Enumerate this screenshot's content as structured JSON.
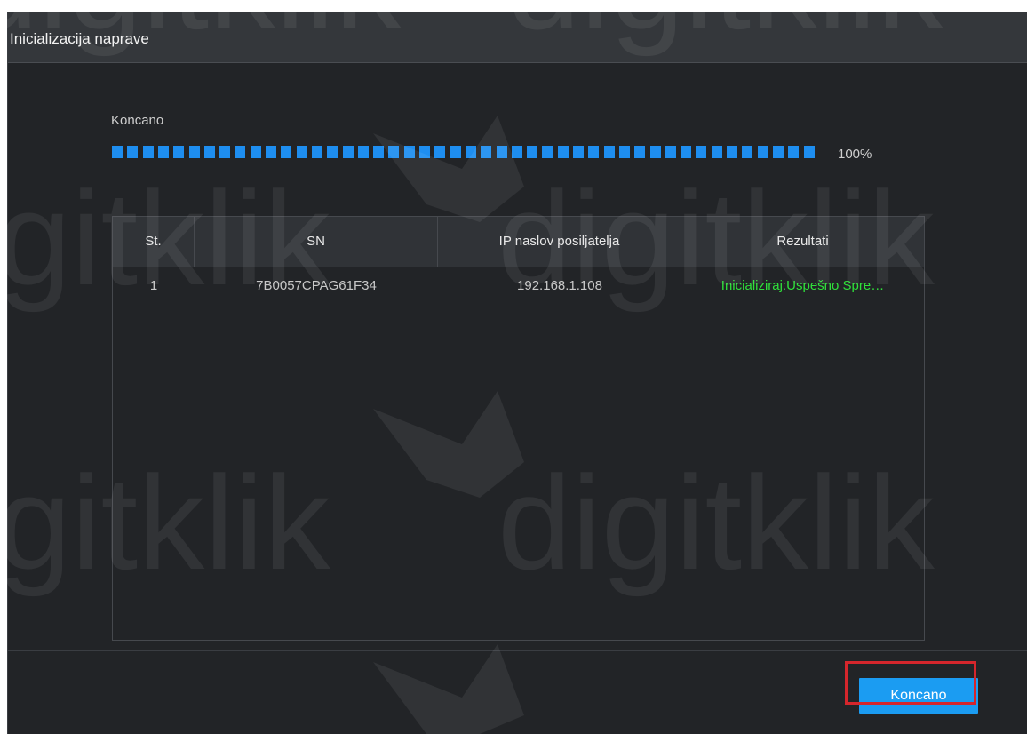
{
  "dialog": {
    "title": "Inicializacija naprave"
  },
  "progress": {
    "label": "Koncano",
    "value": 100,
    "percent_text": "100%",
    "color": "#1e8ef0"
  },
  "table": {
    "columns": [
      "St.",
      "SN",
      "IP naslov posiljatelja",
      "Rezultati"
    ],
    "rows": [
      {
        "no": "1",
        "sn": "7B0057CPAG61F34",
        "ip": "192.168.1.108",
        "result": "Inicializiraj:Uspešno Spre…"
      }
    ]
  },
  "footer": {
    "finish_label": "Koncano"
  },
  "watermark": {
    "text": "digitklik"
  },
  "colors": {
    "accent": "#1b9cf2",
    "success": "#2fe03a",
    "highlight": "#d5262c"
  }
}
